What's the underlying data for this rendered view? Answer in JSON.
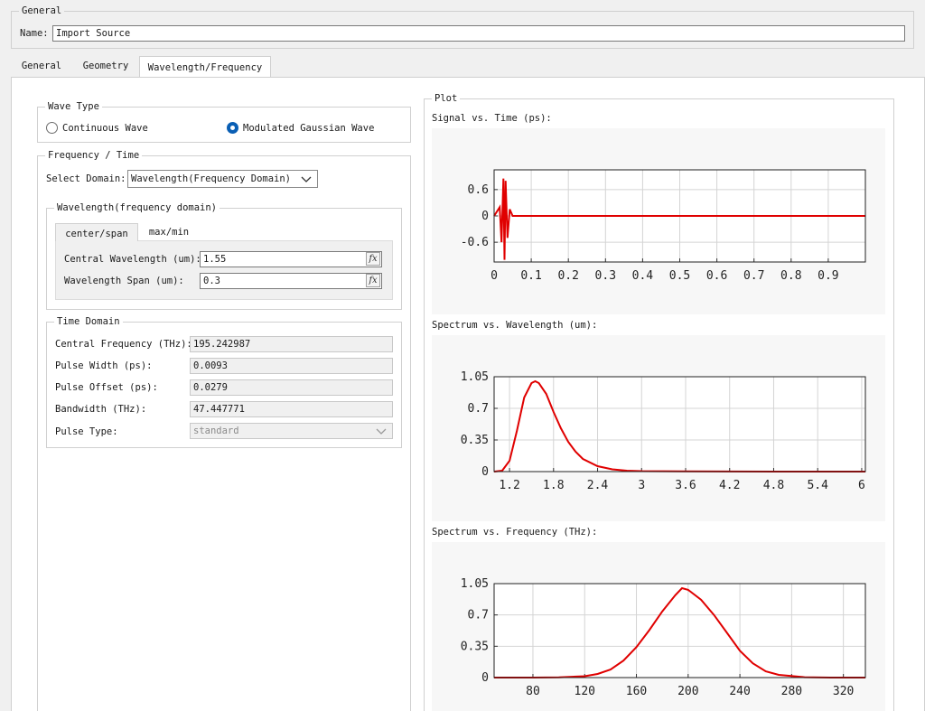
{
  "general": {
    "group_title": "General",
    "name_label": "Name:",
    "name_value": "Import Source"
  },
  "tabs": [
    {
      "label": "General"
    },
    {
      "label": "Geometry"
    },
    {
      "label": "Wavelength/Frequency",
      "active": true
    }
  ],
  "wave_type": {
    "title": "Wave Type",
    "options": [
      {
        "label": "Continuous Wave",
        "checked": false
      },
      {
        "label": "Modulated Gaussian Wave",
        "checked": true
      }
    ]
  },
  "freq_time": {
    "title": "Frequency / Time",
    "select_domain_label": "Select Domain:",
    "select_domain_value": "Wavelength(Frequency Domain)",
    "wavelength_group": {
      "title": "Wavelength(frequency domain)",
      "tabs": [
        {
          "label": "center/span",
          "active": true
        },
        {
          "label": "max/min"
        }
      ],
      "central_wavelength_label": "Central Wavelength (um):",
      "central_wavelength_value": "1.55",
      "wavelength_span_label": "Wavelength Span (um):",
      "wavelength_span_value": "0.3",
      "fx_label": "fx"
    },
    "time_domain": {
      "title": "Time Domain",
      "fields": [
        {
          "label": "Central Frequency (THz):",
          "value": "195.242987"
        },
        {
          "label": "Pulse Width (ps):",
          "value": "0.0093"
        },
        {
          "label": "Pulse Offset (ps):",
          "value": "0.0279"
        },
        {
          "label": "Bandwidth (THz):",
          "value": "47.447771"
        }
      ],
      "pulse_type_label": "Pulse Type:",
      "pulse_type_value": "standard"
    }
  },
  "plot": {
    "title": "Plot",
    "line_color": "#e00000"
  },
  "chart_data": [
    {
      "type": "line",
      "title": "Signal vs. Time (ps):",
      "xlim": [
        0,
        1.0
      ],
      "ylim": [
        -1.05,
        1.05
      ],
      "x_ticks": [
        0,
        0.1,
        0.2,
        0.3,
        0.4,
        0.5,
        0.6,
        0.7,
        0.8,
        0.9
      ],
      "x_tick_labels": [
        "0",
        "0.1",
        "0.2",
        "0.3",
        "0.4",
        "0.5",
        "0.6",
        "0.7",
        "0.8",
        "0.9"
      ],
      "y_ticks": [
        0.6,
        0,
        -0.6
      ],
      "y_tick_labels": [
        "0.6",
        "0",
        "-0.6"
      ],
      "series": [
        {
          "x": [
            0,
            0.015,
            0.02,
            0.025,
            0.0279,
            0.031,
            0.036,
            0.042,
            0.05,
            1.0
          ],
          "y": [
            0,
            0.2,
            -0.6,
            0.85,
            -1.0,
            0.8,
            -0.5,
            0.15,
            0,
            0
          ]
        }
      ]
    },
    {
      "type": "line",
      "title": "Spectrum vs. Wavelength (um):",
      "xlim": [
        0.99,
        6.05
      ],
      "ylim": [
        0,
        1.05
      ],
      "x_ticks": [
        1.2,
        1.8,
        2.4,
        3,
        3.6,
        4.2,
        4.8,
        5.4,
        6
      ],
      "x_tick_labels": [
        "1.2",
        "1.8",
        "2.4",
        "3",
        "3.6",
        "4.2",
        "4.8",
        "5.4",
        "6"
      ],
      "y_ticks": [
        1.05,
        0.7,
        0.35,
        0
      ],
      "y_tick_labels": [
        "1.05",
        "0.7",
        "0.35",
        "0"
      ],
      "series": [
        {
          "x": [
            0.99,
            1.1,
            1.2,
            1.3,
            1.4,
            1.5,
            1.55,
            1.6,
            1.7,
            1.8,
            1.9,
            2.0,
            2.1,
            2.2,
            2.4,
            2.6,
            2.8,
            3.0,
            3.6,
            4.2,
            4.8,
            5.4,
            6.05
          ],
          "y": [
            0,
            0.01,
            0.12,
            0.45,
            0.82,
            0.98,
            1.0,
            0.98,
            0.86,
            0.66,
            0.48,
            0.33,
            0.22,
            0.14,
            0.06,
            0.025,
            0.01,
            0.005,
            0.002,
            0.001,
            0,
            0,
            0
          ]
        }
      ]
    },
    {
      "type": "line",
      "title": "Spectrum vs. Frequency (THz):",
      "xlim": [
        50,
        337
      ],
      "ylim": [
        0,
        1.05
      ],
      "x_ticks": [
        80,
        120,
        160,
        200,
        240,
        280,
        320
      ],
      "x_tick_labels": [
        "80",
        "120",
        "160",
        "200",
        "240",
        "280",
        "320"
      ],
      "y_ticks": [
        1.05,
        0.7,
        0.35,
        0
      ],
      "y_tick_labels": [
        "1.05",
        "0.7",
        "0.35",
        "0"
      ],
      "series": [
        {
          "x": [
            50,
            80,
            100,
            120,
            130,
            140,
            150,
            160,
            170,
            180,
            190,
            195.24,
            200,
            210,
            220,
            230,
            240,
            250,
            260,
            270,
            290,
            310,
            337
          ],
          "y": [
            0,
            0,
            0.002,
            0.015,
            0.04,
            0.09,
            0.19,
            0.34,
            0.53,
            0.74,
            0.92,
            1.0,
            0.98,
            0.87,
            0.7,
            0.5,
            0.3,
            0.16,
            0.07,
            0.03,
            0.004,
            0,
            0
          ]
        }
      ]
    }
  ]
}
